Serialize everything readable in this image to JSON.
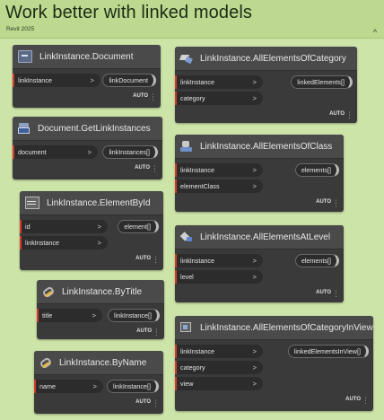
{
  "group": {
    "title": "Work better with linked models",
    "subtitle": "Revit 2025",
    "collapse_glyph": "^"
  },
  "footer": {
    "lacing": "AUTO",
    "menu": "⋮"
  },
  "nodes": {
    "doc": {
      "title": "LinkInstance.Document",
      "icon": "document-icon",
      "inputs": [
        {
          "name": "linkInstance",
          "chev": ">"
        }
      ],
      "outputs": [
        "linkDocument"
      ]
    },
    "getlinks": {
      "title": "Document.GetLinkInstances",
      "icon": "revit-document-icon",
      "inputs": [
        {
          "name": "document",
          "chev": ">"
        }
      ],
      "outputs": [
        "linkInstances[]"
      ]
    },
    "byid": {
      "title": "LinkInstance.ElementById",
      "icon": "table-icon",
      "inputs": [
        {
          "name": "id",
          "chev": ">"
        },
        {
          "name": "linkInstance",
          "chev": ">"
        }
      ],
      "outputs": [
        "element[]"
      ]
    },
    "bytitle": {
      "title": "LinkInstance.ByTitle",
      "icon": "link-icon",
      "inputs": [
        {
          "name": "title",
          "chev": ">"
        }
      ],
      "outputs": [
        "linkInstance[]"
      ]
    },
    "byname": {
      "title": "LinkInstance.ByName",
      "icon": "link-icon",
      "inputs": [
        {
          "name": "name",
          "chev": ">"
        }
      ],
      "outputs": [
        "linkInstance[]"
      ]
    },
    "allcat": {
      "title": "LinkInstance.AllElementsOfCategory",
      "icon": "category-icon",
      "inputs": [
        {
          "name": "linkInstance",
          "chev": ">"
        },
        {
          "name": "category",
          "chev": ">"
        }
      ],
      "outputs": [
        "linkedElements[]"
      ]
    },
    "allclass": {
      "title": "LinkInstance.AllElementsOfClass",
      "icon": "class-icon",
      "inputs": [
        {
          "name": "linkInstance",
          "chev": ">"
        },
        {
          "name": "elementClass",
          "chev": ">"
        }
      ],
      "outputs": [
        "elements[]"
      ]
    },
    "alllevel": {
      "title": "LinkInstance.AllElementsAtLevel",
      "icon": "level-icon",
      "inputs": [
        {
          "name": "linkInstance",
          "chev": ">"
        },
        {
          "name": "level",
          "chev": ">"
        }
      ],
      "outputs": [
        "elements[]"
      ]
    },
    "allview": {
      "title": "LinkInstance.AllElementsOfCategoryInView",
      "icon": "view-icon",
      "inputs": [
        {
          "name": "linkInstance",
          "chev": ">"
        },
        {
          "name": "category",
          "chev": ">"
        },
        {
          "name": "view",
          "chev": ">"
        }
      ],
      "outputs": [
        "linkedElementsInView[]"
      ]
    }
  }
}
